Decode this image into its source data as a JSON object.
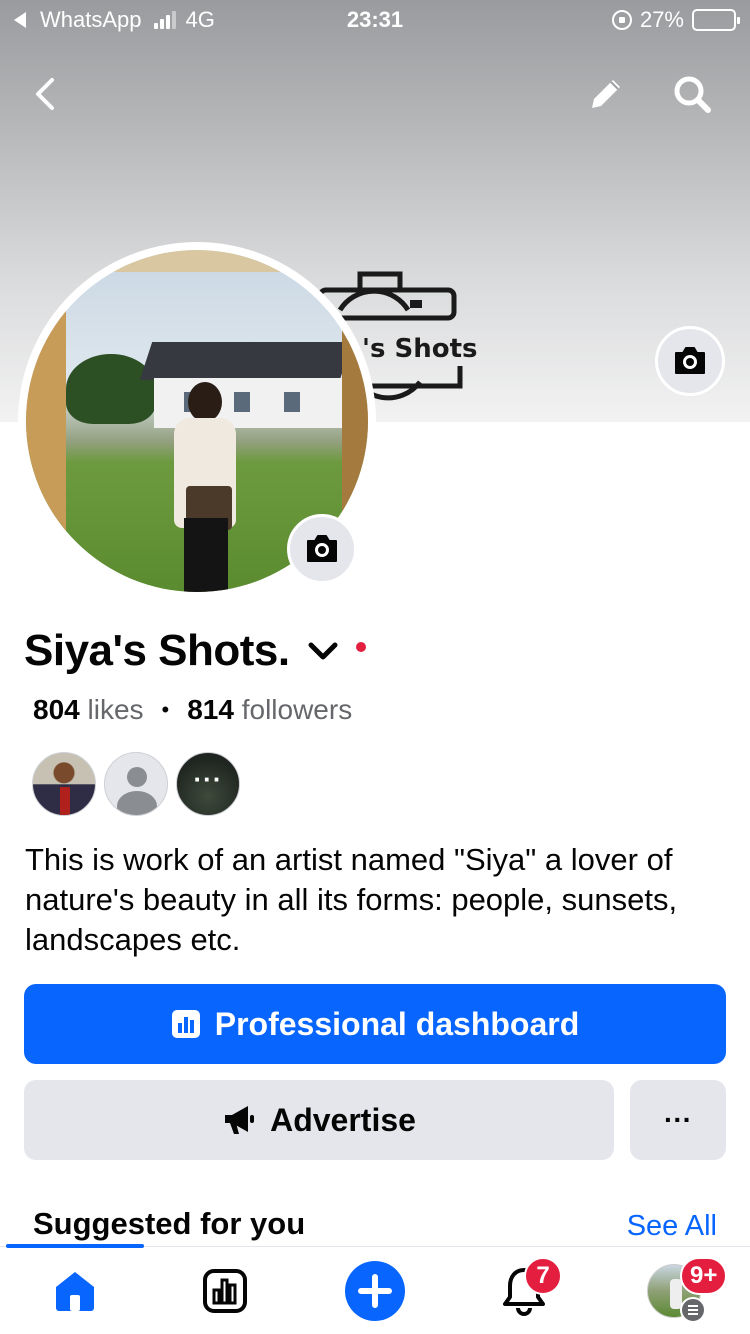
{
  "status_bar": {
    "back_app": "WhatsApp",
    "network": "4G",
    "time": "23:31",
    "battery_percent": "27%",
    "battery_level": 0.27
  },
  "header": {
    "back_icon": "chevron-left-icon",
    "edit_icon": "pencil-icon",
    "search_icon": "search-icon"
  },
  "cover": {
    "logo_text": "'s Shots",
    "camera_icon": "camera-icon"
  },
  "profile": {
    "name": "Siya's Shots.",
    "likes_count": "804",
    "likes_label": "likes",
    "followers_count": "814",
    "followers_label": "followers",
    "more_friends_label": "···",
    "bio": "This is work of an artist named \"Siya\" a lover of nature's beauty in all its forms: people, sunsets, landscapes etc."
  },
  "actions": {
    "dashboard_label": "Professional dashboard",
    "advertise_label": "Advertise",
    "more_label": "···"
  },
  "suggested": {
    "title": "Suggested for you",
    "see_all": "See All"
  },
  "bottom_nav": {
    "notifications_badge": "7",
    "menu_badge": "9+"
  },
  "colors": {
    "accent": "#0866ff",
    "badge": "#e41e3f",
    "button_grey": "#e4e6eb",
    "secondary_text": "#65676b"
  }
}
